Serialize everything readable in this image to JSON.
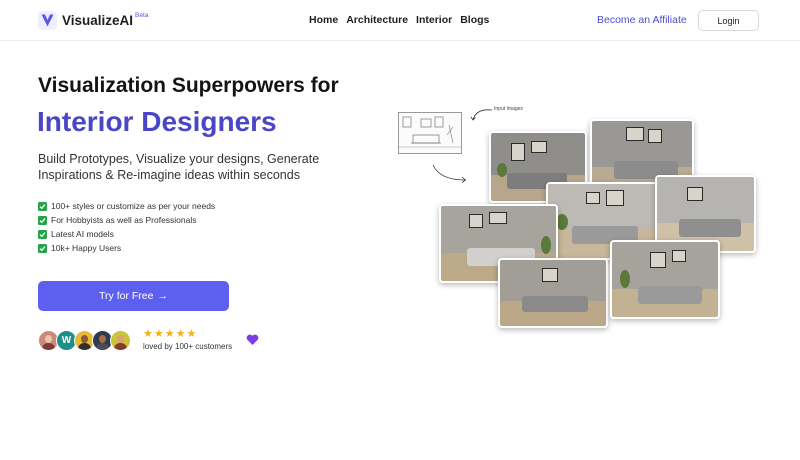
{
  "header": {
    "brand": "VisualizeAI",
    "badge": "Beta",
    "nav": [
      "Home",
      "Architecture",
      "Interior",
      "Blogs"
    ],
    "affiliate_link": "Become an Affiliate",
    "login_label": "Login"
  },
  "hero": {
    "title_line1": "Visualization Superpowers for",
    "title_line2": "Interior Designers",
    "subtitle": "Build Prototypes, Visualize your designs, Generate Inspirations & Re-imagine ideas within seconds",
    "features": [
      "100+ styles or customize as per your needs",
      "For Hobbyists as well as Professionals",
      "Latest AI models",
      "10k+ Happy Users"
    ],
    "cta_label": "Try for Free",
    "cta_arrow": "→"
  },
  "social_proof": {
    "avatar_letter": "W",
    "rating": 5,
    "star_glyph": "★",
    "caption": "loved by 100+ customers",
    "heart_icon": "heart-icon"
  },
  "collage": {
    "input_label": "Input Images",
    "accent": "#5d5fef"
  },
  "colors": {
    "brand": "#5b55ee",
    "title_accent": "#4b46c7",
    "cta": "#5d5fef",
    "check": "#22a447",
    "star": "#f2b01e"
  }
}
